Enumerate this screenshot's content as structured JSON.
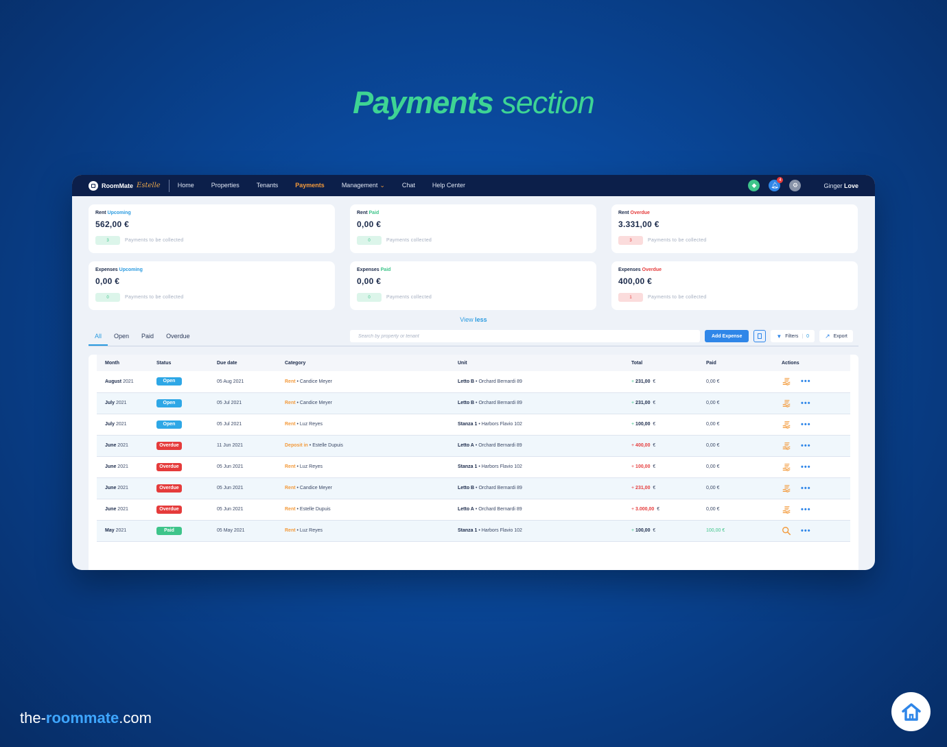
{
  "headline": {
    "bold": "Payments",
    "light": " section"
  },
  "topbar": {
    "logo_text": "RoomMate",
    "logo_script": "Estelle",
    "nav": [
      "Home",
      "Properties",
      "Tenants",
      "Payments",
      "Management",
      "Chat",
      "Help Center"
    ],
    "active_nav": "Payments",
    "notification_count": "4",
    "user_first": "Ginger",
    "user_last": "Love"
  },
  "cards": [
    {
      "kind": "Rent",
      "state": "Upcoming",
      "amount": "562,00 €",
      "count": "3",
      "note": "Payments to be collected"
    },
    {
      "kind": "Rent",
      "state": "Paid",
      "amount": "0,00 €",
      "count": "0",
      "note": "Payments collected"
    },
    {
      "kind": "Rent",
      "state": "Overdue",
      "amount": "3.331,00 €",
      "count": "3",
      "note": "Payments to be collected"
    },
    {
      "kind": "Expenses",
      "state": "Upcoming",
      "amount": "0,00 €",
      "count": "0",
      "note": "Payments to be collected"
    },
    {
      "kind": "Expenses",
      "state": "Paid",
      "amount": "0,00 €",
      "count": "0",
      "note": "Payments collected"
    },
    {
      "kind": "Expenses",
      "state": "Overdue",
      "amount": "400,00 €",
      "count": "1",
      "note": "Payments to be collected"
    }
  ],
  "view_toggle": {
    "prefix": "View",
    "word": "less"
  },
  "tabs": [
    "All",
    "Open",
    "Paid",
    "Overdue"
  ],
  "toolbar": {
    "search_placeholder": "Search by property or tenant",
    "add_expense": "Add Expense",
    "filters": "Filters",
    "filters_count": "0",
    "export": "Export"
  },
  "table": {
    "headers": [
      "Month",
      "Status",
      "Due date",
      "Category",
      "Unit",
      "Total",
      "Paid",
      "Actions"
    ],
    "rows": [
      {
        "month": "August",
        "year": "2021",
        "status": "Open",
        "due": "05 Aug 2021",
        "cat": "Rent",
        "person": "Candice Meyer",
        "unit": "Letto B",
        "address": "Orchard Bernardi 89",
        "sign": "+",
        "total": "231,00",
        "paid": "0,00 €"
      },
      {
        "month": "July",
        "year": "2021",
        "status": "Open",
        "due": "05 Jul 2021",
        "cat": "Rent",
        "person": "Candice Meyer",
        "unit": "Letto B",
        "address": "Orchard Bernardi 89",
        "sign": "+",
        "total": "231,00",
        "paid": "0,00 €"
      },
      {
        "month": "July",
        "year": "2021",
        "status": "Open",
        "due": "05 Jul 2021",
        "cat": "Rent",
        "person": "Luz Reyes",
        "unit": "Stanza 1",
        "address": "Harbors Flavio 102",
        "sign": "+",
        "total": "100,00",
        "paid": "0,00 €"
      },
      {
        "month": "June",
        "year": "2021",
        "status": "Overdue",
        "due": "11 Jun 2021",
        "cat": "Deposit in",
        "person": "Estelle Dupuis",
        "unit": "Letto A",
        "address": "Orchard Bernardi 89",
        "sign": "+",
        "total": "400,00",
        "paid": "0,00 €"
      },
      {
        "month": "June",
        "year": "2021",
        "status": "Overdue",
        "due": "05 Jun 2021",
        "cat": "Rent",
        "person": "Luz Reyes",
        "unit": "Stanza 1",
        "address": "Harbors Flavio 102",
        "sign": "+",
        "total": "100,00",
        "paid": "0,00 €"
      },
      {
        "month": "June",
        "year": "2021",
        "status": "Overdue",
        "due": "05 Jun 2021",
        "cat": "Rent",
        "person": "Candice Meyer",
        "unit": "Letto B",
        "address": "Orchard Bernardi 89",
        "sign": "+",
        "total": "231,00",
        "paid": "0,00 €"
      },
      {
        "month": "June",
        "year": "2021",
        "status": "Overdue",
        "due": "05 Jun 2021",
        "cat": "Rent",
        "person": "Estelle Dupuis",
        "unit": "Letto A",
        "address": "Orchard Bernardi 89",
        "sign": "+",
        "total": "3.000,00",
        "paid": "0,00 €"
      },
      {
        "month": "May",
        "year": "2021",
        "status": "Paid",
        "due": "05 May 2021",
        "cat": "Rent",
        "person": "Luz Reyes",
        "unit": "Stanza 1",
        "address": "Harbors Flavio 102",
        "sign": "+",
        "total": "100,00",
        "paid": "100,00 €"
      }
    ],
    "currency": "€"
  },
  "footer": {
    "url_prefix": "the-",
    "url_bold": "roommate",
    "url_suffix": ".com"
  },
  "colors": {
    "accent": "#2f86e8",
    "green": "#3ec48a",
    "red": "#e53b3b",
    "orange": "#f39a3b",
    "navy": "#0c1f4a"
  }
}
